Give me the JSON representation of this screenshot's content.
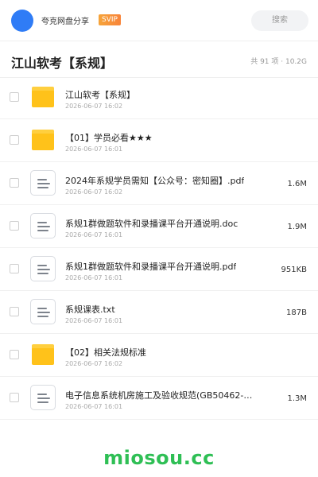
{
  "header": {
    "share_name": "夸克网盘分享",
    "badge": "SVIP",
    "search_placeholder": "搜索"
  },
  "folder": {
    "title": "江山软考【系规】",
    "meta": "共 91 项 · 10.2G"
  },
  "items": [
    {
      "type": "folder",
      "name": "江山软考【系规】",
      "date": "2026-06-07 16:02",
      "size": ""
    },
    {
      "type": "folder",
      "name": "【01】学员必看★★★",
      "date": "2026-06-07 16:01",
      "size": ""
    },
    {
      "type": "file",
      "name": "2024年系规学员需知【公众号：密知圈】.pdf",
      "date": "2026-06-07 16:02",
      "size": "1.6M"
    },
    {
      "type": "file",
      "name": "系规1群做题软件和录播课平台开通说明.doc",
      "date": "2026-06-07 16:01",
      "size": "1.9M"
    },
    {
      "type": "file",
      "name": "系规1群做题软件和录播课平台开通说明.pdf",
      "date": "2026-06-07 16:01",
      "size": "951KB"
    },
    {
      "type": "file",
      "name": "系规课表.txt",
      "date": "2026-06-07 16:01",
      "size": "187B"
    },
    {
      "type": "folder",
      "name": "【02】相关法规标准",
      "date": "2026-06-07 16:02",
      "size": ""
    },
    {
      "type": "file",
      "name": "电子信息系统机房施工及验收规范(GB50462-2…",
      "date": "2026-06-07 16:01",
      "size": "1.3M"
    }
  ],
  "footer": {
    "brand": "miosou.cc"
  },
  "colors": {
    "accent": "#2f7cf6",
    "folder": "#ffc21a",
    "brand": "#2fbf55",
    "svip": "#f8843a"
  }
}
